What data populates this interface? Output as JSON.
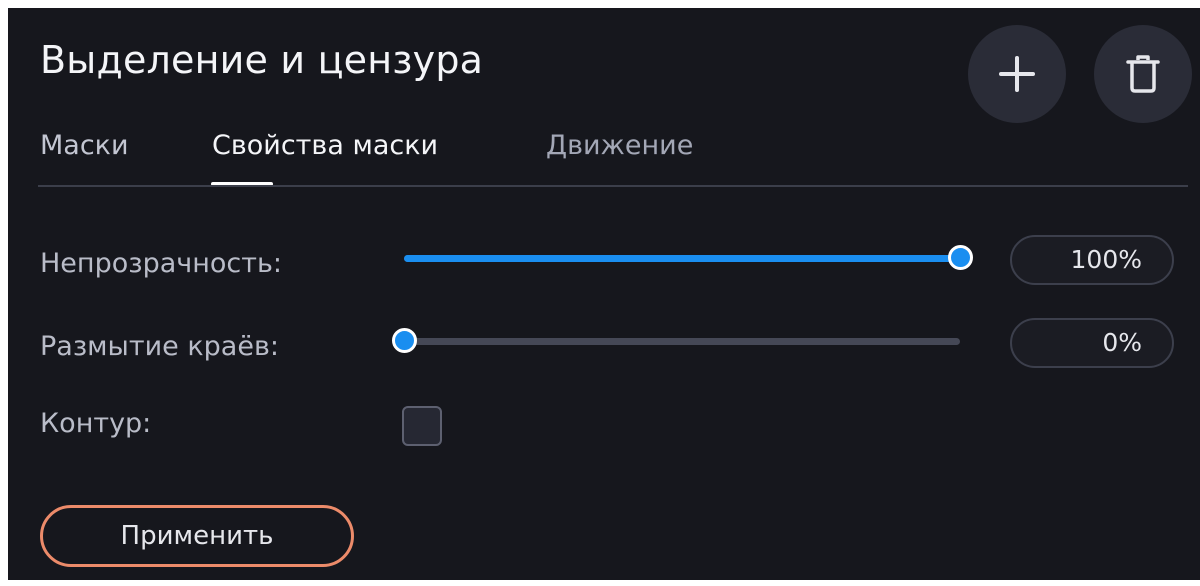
{
  "panel": {
    "title": "Выделение и цензура",
    "actions": {
      "add_icon": "plus-icon",
      "delete_icon": "trash-icon"
    }
  },
  "tabs": [
    {
      "label": "Маски",
      "active": false
    },
    {
      "label": "Свойства маски",
      "active": true
    },
    {
      "label": "Движение",
      "active": false
    }
  ],
  "settings": {
    "opacity": {
      "label": "Непрозрачность:",
      "value": 100,
      "display": "100%"
    },
    "feather": {
      "label": "Размытие краёв:",
      "value": 0,
      "display": "0%"
    },
    "outline": {
      "label": "Контур:",
      "checked": false
    }
  },
  "apply_label": "Применить",
  "colors": {
    "background": "#16171d",
    "accent": "#1a8ef0",
    "apply_border": "#ec8b6a"
  }
}
